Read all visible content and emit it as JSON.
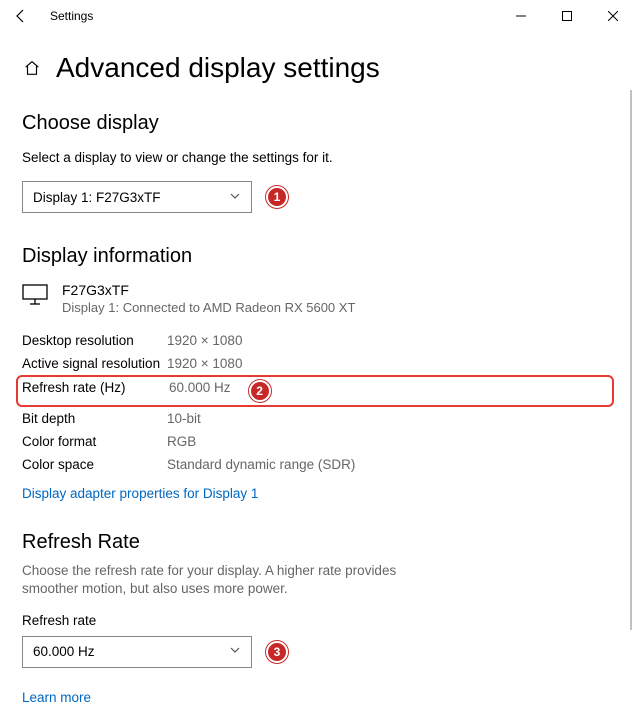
{
  "app": {
    "title": "Settings"
  },
  "page": {
    "title": "Advanced display settings"
  },
  "choose": {
    "heading": "Choose display",
    "help": "Select a display to view or change the settings for it.",
    "selected": "Display 1: F27G3xTF"
  },
  "info": {
    "heading": "Display information",
    "monitor_name": "F27G3xTF",
    "monitor_sub": "Display 1: Connected to AMD Radeon RX 5600 XT",
    "rows": [
      {
        "label": "Desktop resolution",
        "value": "1920 × 1080"
      },
      {
        "label": "Active signal resolution",
        "value": "1920 × 1080"
      },
      {
        "label": "Refresh rate (Hz)",
        "value": "60.000 Hz"
      },
      {
        "label": "Bit depth",
        "value": "10-bit"
      },
      {
        "label": "Color format",
        "value": "RGB"
      },
      {
        "label": "Color space",
        "value": "Standard dynamic range (SDR)"
      }
    ],
    "adapter_link": "Display adapter properties for Display 1"
  },
  "refresh": {
    "heading": "Refresh Rate",
    "help": "Choose the refresh rate for your display. A higher rate provides smoother motion, but also uses more power.",
    "label": "Refresh rate",
    "selected": "60.000 Hz",
    "learn_more": "Learn more"
  },
  "callouts": {
    "one": "1",
    "two": "2",
    "three": "3"
  }
}
